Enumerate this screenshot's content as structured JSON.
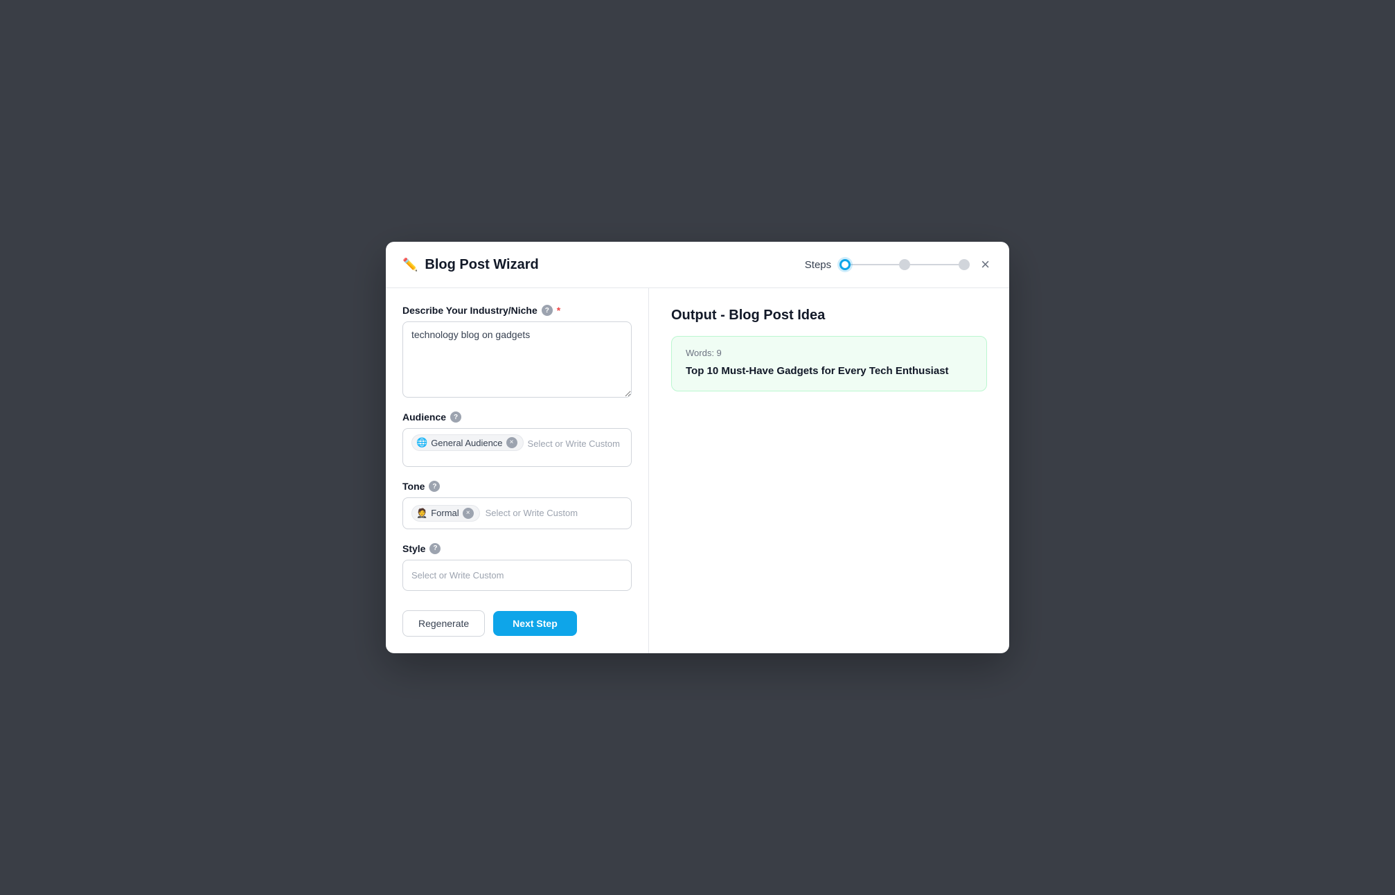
{
  "modal": {
    "title": "Blog Post Wizard",
    "close_label": "×",
    "steps_label": "Steps"
  },
  "steps": {
    "step1": "active",
    "step2": "inactive",
    "step3": "inactive"
  },
  "left": {
    "industry_label": "Describe Your Industry/Niche",
    "industry_value": "technology blog on gadgets",
    "audience_label": "Audience",
    "audience_tag_emoji": "🌐",
    "audience_tag_text": "General Audience",
    "audience_placeholder": "Select or Write Custom",
    "tone_label": "Tone",
    "tone_tag_emoji": "🤵",
    "tone_tag_text": "Formal",
    "tone_placeholder": "Select or Write Custom",
    "style_label": "Style",
    "style_placeholder": "Select or Write Custom"
  },
  "footer": {
    "regenerate_label": "Regenerate",
    "next_label": "Next Step"
  },
  "output": {
    "title": "Output - Blog Post Idea",
    "words_label": "Words: 9",
    "content": "Top 10 Must-Have Gadgets for Every Tech Enthusiast"
  }
}
